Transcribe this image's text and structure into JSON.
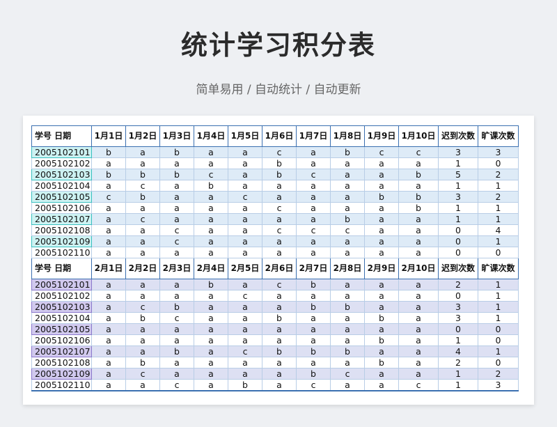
{
  "title": "统计学习积分表",
  "subtitle": "简单易用 / 自动统计 / 自动更新",
  "block1": {
    "headers": [
      "学号  日期",
      "1月1日",
      "1月2日",
      "1月3日",
      "1月4日",
      "1月5日",
      "1月6日",
      "1月7日",
      "1月8日",
      "1月9日",
      "1月10日",
      "迟到次数",
      "旷课次数"
    ],
    "rows": [
      [
        "2005102101",
        "b",
        "a",
        "b",
        "a",
        "a",
        "c",
        "a",
        "b",
        "c",
        "c",
        "3",
        "3"
      ],
      [
        "2005102102",
        "a",
        "a",
        "a",
        "a",
        "a",
        "b",
        "a",
        "a",
        "a",
        "a",
        "1",
        "0"
      ],
      [
        "2005102103",
        "b",
        "b",
        "b",
        "c",
        "a",
        "b",
        "c",
        "a",
        "a",
        "b",
        "5",
        "2"
      ],
      [
        "2005102104",
        "a",
        "c",
        "a",
        "b",
        "a",
        "a",
        "a",
        "a",
        "a",
        "a",
        "1",
        "1"
      ],
      [
        "2005102105",
        "c",
        "b",
        "a",
        "a",
        "c",
        "a",
        "a",
        "a",
        "b",
        "b",
        "3",
        "2"
      ],
      [
        "2005102106",
        "a",
        "a",
        "a",
        "a",
        "a",
        "c",
        "a",
        "a",
        "a",
        "b",
        "1",
        "1"
      ],
      [
        "2005102107",
        "a",
        "c",
        "a",
        "a",
        "a",
        "a",
        "a",
        "b",
        "a",
        "a",
        "1",
        "1"
      ],
      [
        "2005102108",
        "a",
        "a",
        "c",
        "a",
        "a",
        "c",
        "c",
        "c",
        "a",
        "a",
        "0",
        "4"
      ],
      [
        "2005102109",
        "a",
        "a",
        "c",
        "a",
        "a",
        "a",
        "a",
        "a",
        "a",
        "a",
        "0",
        "1"
      ],
      [
        "2005102110",
        "a",
        "a",
        "a",
        "a",
        "a",
        "a",
        "a",
        "a",
        "a",
        "a",
        "0",
        "0"
      ]
    ]
  },
  "block2": {
    "headers": [
      "学号  日期",
      "2月1日",
      "2月2日",
      "2月3日",
      "2月4日",
      "2月5日",
      "2月6日",
      "2月7日",
      "2月8日",
      "2月9日",
      "2月10日",
      "迟到次数",
      "旷课次数"
    ],
    "rows": [
      [
        "2005102101",
        "a",
        "a",
        "a",
        "b",
        "a",
        "c",
        "b",
        "a",
        "a",
        "a",
        "2",
        "1"
      ],
      [
        "2005102102",
        "a",
        "a",
        "a",
        "a",
        "c",
        "a",
        "a",
        "a",
        "a",
        "a",
        "0",
        "1"
      ],
      [
        "2005102103",
        "a",
        "c",
        "b",
        "a",
        "a",
        "a",
        "b",
        "b",
        "a",
        "a",
        "3",
        "1"
      ],
      [
        "2005102104",
        "a",
        "b",
        "c",
        "a",
        "a",
        "b",
        "a",
        "a",
        "b",
        "a",
        "3",
        "1"
      ],
      [
        "2005102105",
        "a",
        "a",
        "a",
        "a",
        "a",
        "a",
        "a",
        "a",
        "a",
        "a",
        "0",
        "0"
      ],
      [
        "2005102106",
        "a",
        "a",
        "a",
        "a",
        "a",
        "a",
        "a",
        "a",
        "b",
        "a",
        "1",
        "0"
      ],
      [
        "2005102107",
        "a",
        "a",
        "b",
        "a",
        "c",
        "b",
        "b",
        "b",
        "a",
        "a",
        "4",
        "1"
      ],
      [
        "2005102108",
        "a",
        "b",
        "a",
        "a",
        "a",
        "a",
        "a",
        "a",
        "b",
        "a",
        "2",
        "0"
      ],
      [
        "2005102109",
        "a",
        "c",
        "a",
        "a",
        "a",
        "a",
        "b",
        "c",
        "a",
        "a",
        "1",
        "2"
      ],
      [
        "2005102110",
        "a",
        "a",
        "c",
        "a",
        "b",
        "a",
        "c",
        "a",
        "a",
        "c",
        "1",
        "3"
      ]
    ]
  }
}
